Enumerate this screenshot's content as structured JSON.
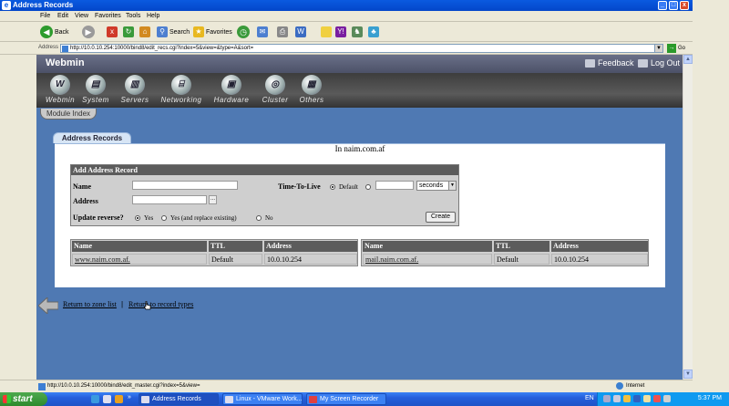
{
  "window": {
    "title": "Address Records"
  },
  "menu": [
    "File",
    "Edit",
    "View",
    "Favorites",
    "Tools",
    "Help"
  ],
  "toolbar": {
    "back_label": "Back",
    "search_label": "Search",
    "favorites_label": "Favorites"
  },
  "address_bar": {
    "label": "Address",
    "url": "http://10.0.10.254:10000/bind8/edit_recs.cgi?index=5&view=&type=A&sort=",
    "go_label": "Go"
  },
  "webmin": {
    "logo": "Webmin",
    "feedback": "Feedback",
    "logout": "Log Out",
    "nav": [
      "Webmin",
      "System",
      "Servers",
      "Networking",
      "Hardware",
      "Cluster",
      "Others"
    ],
    "module_index": "Module Index"
  },
  "page": {
    "tab": "Address Records",
    "title": "In naim.com.af",
    "form": {
      "heading": "Add Address Record",
      "name_label": "Name",
      "address_label": "Address",
      "ttl_label": "Time-To-Live",
      "ttl_default": "Default",
      "ttl_unit": "seconds",
      "reverse_label": "Update reverse?",
      "reverse_options": [
        "Yes",
        "Yes (and replace existing)",
        "No"
      ],
      "address_button": "...",
      "create_button": "Create"
    },
    "table_headers": [
      "Name",
      "TTL",
      "Address"
    ],
    "records_left": [
      {
        "name": "www.naim.com.af.",
        "ttl": "Default",
        "address": "10.0.10.254"
      }
    ],
    "records_right": [
      {
        "name": "mail.naim.com.af.",
        "ttl": "Default",
        "address": "10.0.10.254"
      }
    ],
    "return_zone": "Return to zone list",
    "separator": "|",
    "return_types": "Return to record types"
  },
  "status": {
    "text": "http://10.0.10.254:10000/bind8/edit_master.cgi?index=5&view=",
    "zone": "Internet"
  },
  "taskbar": {
    "start": "start",
    "tasks": [
      "Address Records",
      "Linux - VMware Work...",
      "My Screen Recorder"
    ],
    "lang": "EN",
    "clock": "5:37 PM"
  }
}
